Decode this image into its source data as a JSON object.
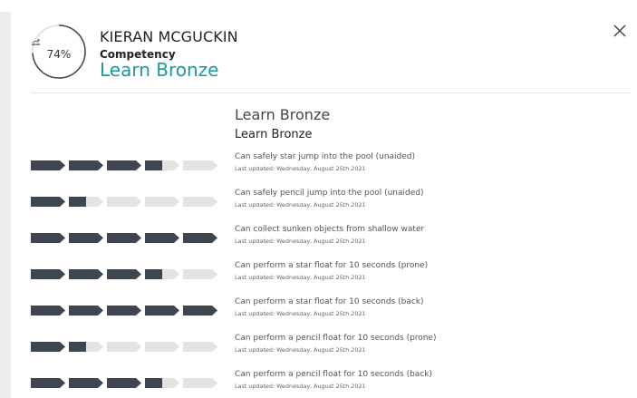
{
  "header": {
    "student_name": "KIERAN MCGUCKIN",
    "category": "Competency",
    "level": "Learn Bronze",
    "progress": {
      "percent_label": "74%",
      "fraction": 0.74,
      "icon": "swimmer-icon"
    },
    "close_icon": "close-icon"
  },
  "section": {
    "title": "Learn Bronze",
    "subtitle": "Learn Bronze"
  },
  "colors": {
    "accent": "#1c9a9a",
    "segment_filled": "#3d4651",
    "segment_empty": "#e3e3e3",
    "ring": "#4d4d4d"
  },
  "skills": [
    {
      "label": "Can safely star jump into the pool (unaided)",
      "updated": "Last updated: Wednesday, August 25th 2021",
      "progress": 3.5,
      "segments": 5
    },
    {
      "label": "Can safely pencil jump into the pool (unaided)",
      "updated": "Last updated: Wednesday, August 25th 2021",
      "progress": 1.5,
      "segments": 5
    },
    {
      "label": "Can collect sunken objects from shallow water",
      "updated": "Last updated: Wednesday, August 25th 2021",
      "progress": 5,
      "segments": 5
    },
    {
      "label": "Can perform a star float for 10 seconds (prone)",
      "updated": "Last updated: Wednesday, August 25th 2021",
      "progress": 3.5,
      "segments": 5
    },
    {
      "label": "Can perform a star float for 10 seconds (back)",
      "updated": "Last updated: Wednesday, August 25th 2021",
      "progress": 5,
      "segments": 5
    },
    {
      "label": "Can perform a pencil float for 10 seconds (prone)",
      "updated": "Last updated: Wednesday, August 25th 2021",
      "progress": 1.5,
      "segments": 5
    },
    {
      "label": "Can perform a pencil float for 10 seconds (back)",
      "updated": "Last updated: Wednesday, August 25th 2021",
      "progress": 3.5,
      "segments": 5
    }
  ]
}
